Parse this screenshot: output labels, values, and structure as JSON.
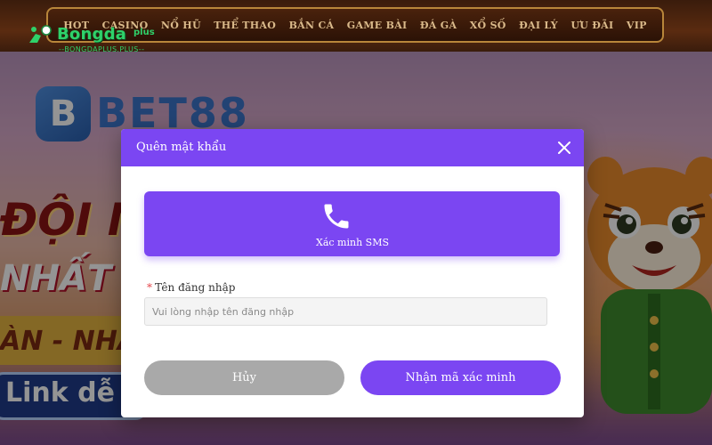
{
  "nav": {
    "items": [
      "HOT",
      "CASINO",
      "NỔ HŨ",
      "THỂ THAO",
      "BẮN CÁ",
      "GAME BÀI",
      "ĐÁ GÀ",
      "XỔ SỐ",
      "ĐẠI LÝ",
      "ƯU ĐÃI",
      "VIP"
    ]
  },
  "watermark": {
    "name": "Bongda",
    "suffix": "plus",
    "url": "--BONGDAPLUS.PLUS--"
  },
  "background": {
    "brand": "BET88",
    "promo_line1": "ĐỘI N",
    "promo_line2": "NHẤT",
    "promo_line3": "ÀN - NHAN",
    "link_text": "Link dễ n"
  },
  "modal": {
    "title": "Quên mật khẩu",
    "close_icon": "close-icon",
    "sms_option": {
      "icon": "phone-icon",
      "label": "Xác minh SMS"
    },
    "username": {
      "required_mark": "*",
      "label": "Tên đăng nhập",
      "placeholder": "Vui lòng nhập tên đăng nhập",
      "value": ""
    },
    "cancel_label": "Hủy",
    "confirm_label": "Nhận mã xác minh"
  },
  "colors": {
    "accent": "#7b46f2",
    "cancel": "#a9a9a9"
  }
}
